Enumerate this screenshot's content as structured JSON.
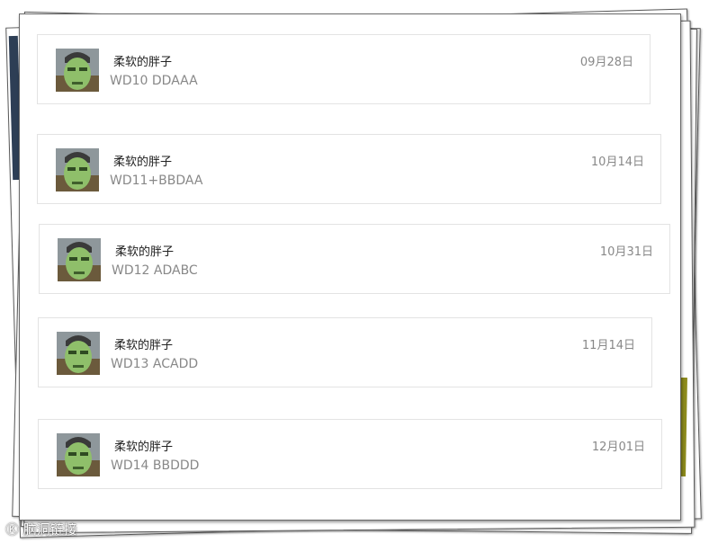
{
  "comments": [
    {
      "author": "柔软的胖子",
      "text": "WD10 DDAAA",
      "date": "09月28日"
    },
    {
      "author": "柔软的胖子",
      "text": "WD11+BBDAA",
      "date": "10月14日"
    },
    {
      "author": "柔软的胖子",
      "text": "WD12 ADABC",
      "date": "10月31日"
    },
    {
      "author": "柔软的胖子",
      "text": "WD13 ACADD",
      "date": "11月14日"
    },
    {
      "author": "柔软的胖子",
      "text": "WD14 BBDDD",
      "date": "12月01日"
    }
  ],
  "icons": {
    "avatar": "hulk-mask-avatar"
  },
  "watermark": "Ⓚ 脑洞链接"
}
